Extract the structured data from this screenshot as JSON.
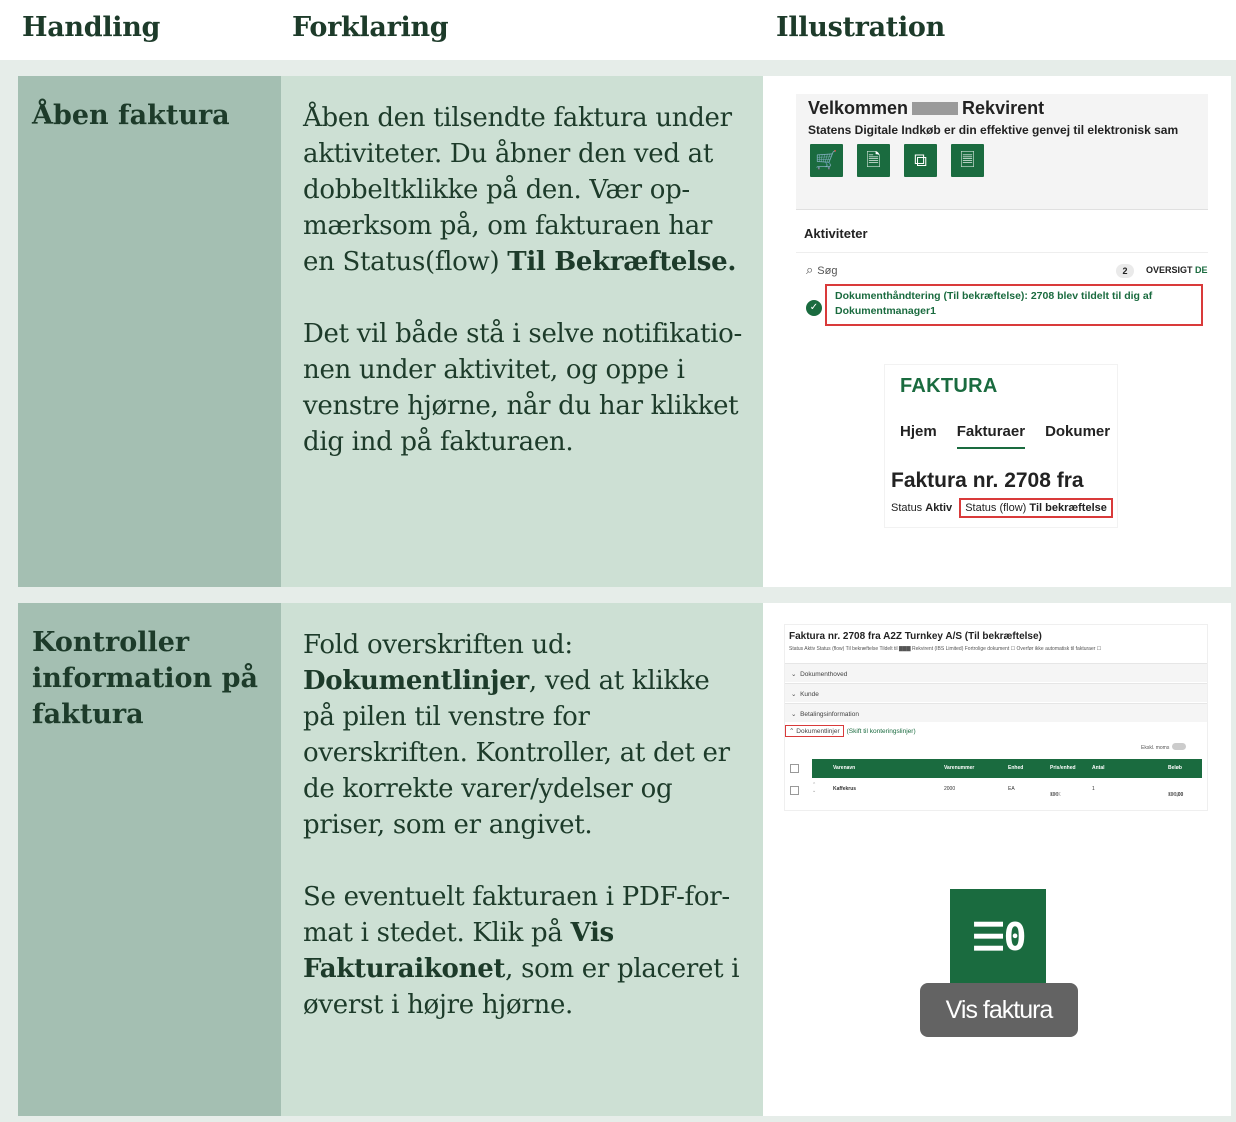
{
  "headers": {
    "col1": "Handling",
    "col2": "Forklaring",
    "col3": "Illustration"
  },
  "row1": {
    "action": "Åben faktura",
    "p1_text": "Åben den tilsendte faktura under aktiviteter. Du åbner den ved at dobbeltklikke på den. Vær op­mærksom på, om fakturaen har en Status(flow) ",
    "p1_bold": "Til Bekræftelse.",
    "p2": "Det vil både stå i selve notifikatio­nen under aktivitet, og oppe i ven­stre hjørne, når du har klikket dig ind på fakturaen.",
    "illustration": {
      "welcome_pre": "Velkommen",
      "welcome_post": "Rekvirent",
      "welcome_sub": "Statens Digitale Indkøb er din effektive genvej til elektronisk sam",
      "tile_icons": [
        "cart-icon",
        "document-add-icon",
        "document-compare-icon",
        "document-icon"
      ],
      "activities_title": "Aktiviteter",
      "search_placeholder": "Søg",
      "count": "2",
      "overview": "OVERSIGT",
      "overview_tail": "DE",
      "notification_line1": "Dokumenthåndtering (Til bekræftelse): 2708 blev tildelt til dig af",
      "notification_line2": "Dokumentmanager1",
      "faktura_header": "FAKTURA",
      "tabs": [
        "Hjem",
        "Fakturaer",
        "Dokumer"
      ],
      "faktura_number": "Faktura nr. 2708 fra",
      "status_label": "Status",
      "status_value": "Aktiv",
      "flow_label": "Status (flow)",
      "flow_value": "Til bekræftelse"
    }
  },
  "row2": {
    "action": "Kontroller information på faktura",
    "p1_pre": "Fold overskriften ud: ",
    "p1_bold": "Dokumentlinjer",
    "p1_post": ", ved at klikke på pilen til venstre for overskriften. Kontroller, at det er de korrekte varer/ydelser og priser, som er an­givet.",
    "p2_pre": "Se eventuelt fakturaen i PDF-for­mat i stedet. Klik på ",
    "p2_bold": "Vis Faktura­ikonet",
    "p2_post": ", som er placeret i øverst i højre hjørne.",
    "illustration": {
      "doc_title": "Faktura nr. 2708 fra A2Z Turnkey A/S (Til bekræftelse)",
      "doc_meta": "Status Aktiv   Status (flow) Til bekræftelse   Tildelt til ▇▇▇ Rekvirent (IBS Limited)   Fortrolige dokument ☐   Overfør ikke automatisk til fakturaer ☐",
      "sections": [
        "Dokumenthoved",
        "Kunde",
        "Betalingsinformation"
      ],
      "open_section": "Dokumentlinjer",
      "switch_link": "(Skift til konteringslinjer)",
      "ekskl_moms": "Ekskl. moms",
      "columns": [
        "Varenavn",
        "Varenummer",
        "Enhed",
        "Pris/enhed",
        "Antal",
        "Beløb"
      ],
      "row": [
        "Kaffekrus",
        "2000",
        "EA",
        "100",
        "1",
        "100,00"
      ],
      "row_units": [
        "DKK",
        "DKK"
      ],
      "vis_label": "Vis faktura"
    }
  },
  "colors": {
    "col1_bg": "#a4bfb2",
    "col2_bg": "#cde0d4",
    "frame_bg": "#e6ede9",
    "brand_green": "#1a6b3f",
    "highlight_red": "#d93a3a"
  }
}
